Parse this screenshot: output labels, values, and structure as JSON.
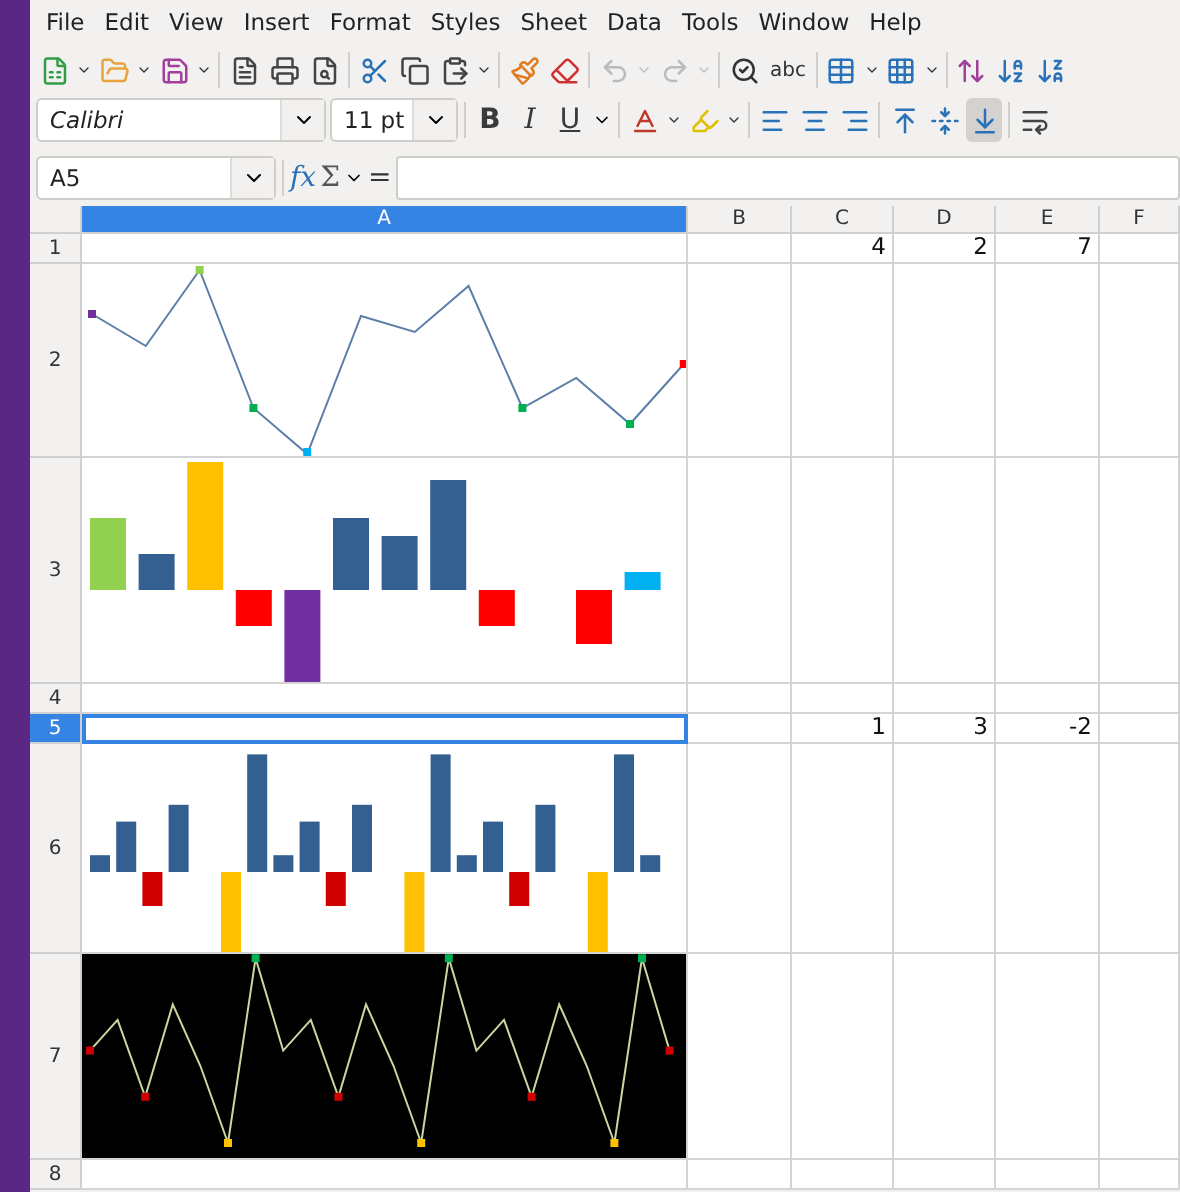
{
  "menu": [
    "File",
    "Edit",
    "View",
    "Insert",
    "Format",
    "Styles",
    "Sheet",
    "Data",
    "Tools",
    "Window",
    "Help"
  ],
  "history_buttons": [
    {
      "kind": "undo",
      "disabled": true
    },
    {
      "kind": "redo",
      "disabled": true
    }
  ],
  "spelling_label": "abc",
  "font_name": "Calibri",
  "font_size": "11 pt",
  "style_buttons": [
    {
      "kind": "bold",
      "label": "B"
    },
    {
      "kind": "italic",
      "label": "I"
    },
    {
      "kind": "underline",
      "label": "U"
    }
  ],
  "align_buttons": [
    {
      "kind": "left",
      "selected": false
    },
    {
      "kind": "center",
      "selected": false
    },
    {
      "kind": "right",
      "selected": false
    },
    {
      "kind": "top",
      "selected": false
    },
    {
      "kind": "middle",
      "selected": false
    },
    {
      "kind": "bottom",
      "selected": true
    }
  ],
  "name_box": "A5",
  "formula_bar": {
    "function_label": "fx",
    "sum_label": "Σ",
    "equals_label": "="
  },
  "columns": [
    {
      "label": "A",
      "selected": true
    },
    {
      "label": "B",
      "selected": false
    },
    {
      "label": "C",
      "selected": false
    },
    {
      "label": "D",
      "selected": false
    },
    {
      "label": "E",
      "selected": false
    },
    {
      "label": "F",
      "selected": false
    }
  ],
  "rows": [
    {
      "label": "1",
      "selected": false,
      "cells": {
        "C": "4",
        "D": "2",
        "E": "7"
      }
    },
    {
      "label": "2",
      "selected": false,
      "kind": "line"
    },
    {
      "label": "3",
      "selected": false,
      "kind": "column"
    },
    {
      "label": "4",
      "selected": false
    },
    {
      "label": "5",
      "selected": true,
      "cells": {
        "C": "1",
        "D": "3",
        "E": "-2"
      }
    },
    {
      "label": "6",
      "selected": false,
      "kind": "pattern"
    },
    {
      "label": "7",
      "selected": false,
      "kind": "darkline"
    },
    {
      "label": "8",
      "selected": false
    }
  ]
}
